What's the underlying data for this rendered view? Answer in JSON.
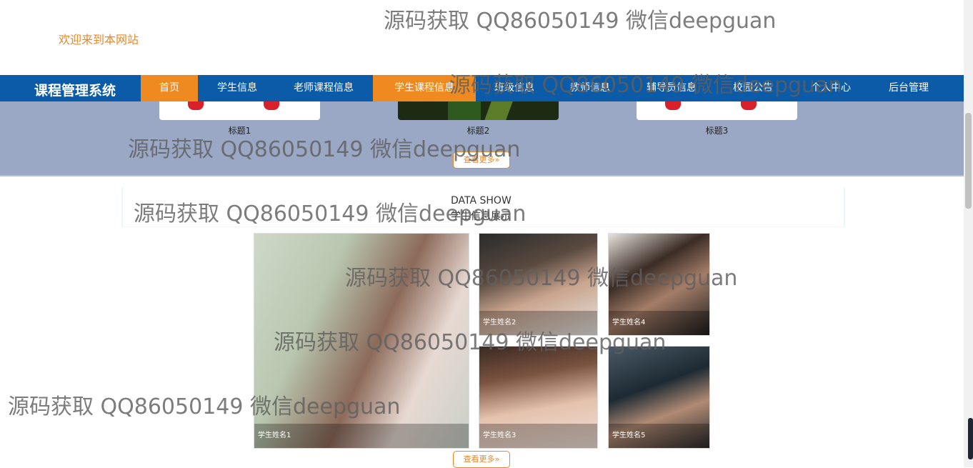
{
  "header": {
    "welcome": "欢迎来到本网站"
  },
  "nav": {
    "brand": "课程管理系统",
    "items": [
      {
        "label": "首页",
        "active": true
      },
      {
        "label": "学生信息",
        "active": false
      },
      {
        "label": "老师课程信息",
        "active": false
      },
      {
        "label": "学生课程信息",
        "active": true
      },
      {
        "label": "班级信息",
        "active": false
      },
      {
        "label": "教师信息",
        "active": false
      },
      {
        "label": "辅导员信息",
        "active": false
      },
      {
        "label": "校园公告",
        "active": false
      },
      {
        "label": "个人中心",
        "active": false
      },
      {
        "label": "后台管理",
        "active": false
      }
    ]
  },
  "news": {
    "cards": [
      {
        "title": "标题1"
      },
      {
        "title": "标题2"
      },
      {
        "title": "标题3"
      }
    ],
    "more": "查看更多»"
  },
  "section": {
    "title_en": "DATA SHOW",
    "title_cn": "学生信息展示"
  },
  "students": {
    "items": [
      {
        "name": "学生姓名1"
      },
      {
        "name": "学生姓名2"
      },
      {
        "name": "学生姓名3"
      },
      {
        "name": "学生姓名4"
      },
      {
        "name": "学生姓名5"
      }
    ],
    "more": "查看更多»"
  },
  "watermark": {
    "text": "源码获取 QQ86050149 微信deepguan"
  },
  "colors": {
    "nav_bg": "#0b5ba8",
    "accent": "#ee8a1f",
    "band_bg": "#9aa8c6"
  }
}
